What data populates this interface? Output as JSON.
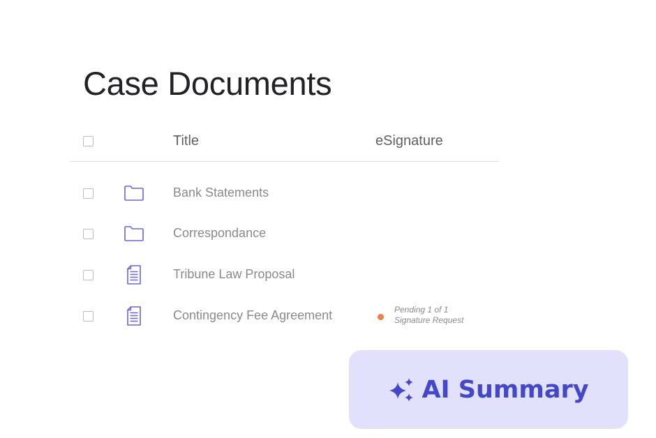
{
  "page": {
    "title": "Case Documents"
  },
  "table": {
    "columns": {
      "title": "Title",
      "esignature": "eSignature"
    },
    "rows": [
      {
        "type": "folder",
        "icon": "folder-icon",
        "name": "Bank Statements",
        "status": null
      },
      {
        "type": "folder",
        "icon": "folder-icon",
        "name": "Correspondance",
        "status": null
      },
      {
        "type": "document",
        "icon": "document-icon",
        "name": "Tribune Law Proposal",
        "status": null
      },
      {
        "type": "document",
        "icon": "document-icon",
        "name": "Contingency Fee Agreement",
        "status": {
          "line1": "Pending 1 of 1",
          "line2": "Signature Request",
          "color": "#f0804a"
        }
      }
    ]
  },
  "ai_summary": {
    "icon": "sparkle-icon",
    "label": "AI Summary"
  },
  "colors": {
    "accent": "#4547c9",
    "icon_purple": "#6b63d6",
    "button_bg": "#e1e1fb",
    "pending": "#f0804a"
  }
}
